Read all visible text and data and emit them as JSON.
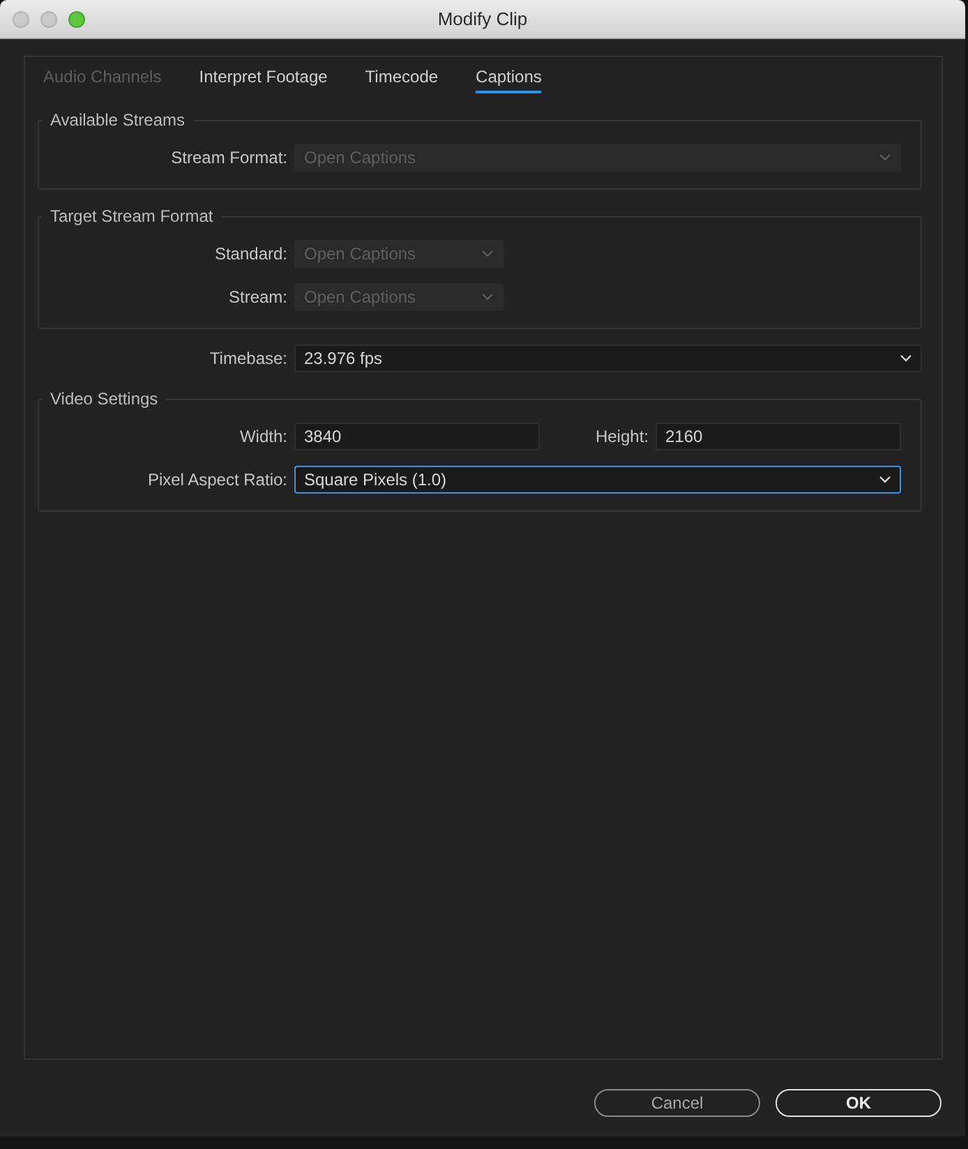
{
  "window": {
    "title": "Modify Clip"
  },
  "tabs": [
    {
      "label": "Audio Channels",
      "selected": false,
      "disabled": true
    },
    {
      "label": "Interpret Footage",
      "selected": false,
      "disabled": false
    },
    {
      "label": "Timecode",
      "selected": false,
      "disabled": false
    },
    {
      "label": "Captions",
      "selected": true,
      "disabled": false
    }
  ],
  "sections": [
    {
      "kind": "group",
      "title": "Available Streams",
      "rows": [
        {
          "fields": [
            {
              "kind": "dropdown",
              "label": "Stream Format:",
              "value": "Open Captions",
              "disabled": true,
              "focused": false
            }
          ]
        }
      ]
    },
    {
      "kind": "group",
      "title": "Target Stream Format",
      "rows": [
        {
          "fields": [
            {
              "kind": "compact-dropdown",
              "label": "Standard:",
              "value": "Open Captions",
              "disabled": true,
              "focused": false
            }
          ]
        },
        {
          "fields": [
            {
              "kind": "compact-dropdown",
              "label": "Stream:",
              "value": "Open Captions",
              "disabled": true,
              "focused": false
            }
          ]
        }
      ]
    },
    {
      "kind": "row",
      "fields": [
        {
          "kind": "dropdown",
          "label": "Timebase:",
          "value": "23.976 fps",
          "disabled": false,
          "focused": false
        }
      ]
    },
    {
      "kind": "group",
      "title": "Video Settings",
      "rows": [
        {
          "fields": [
            {
              "kind": "text",
              "label": "Width:",
              "value": "3840",
              "disabled": false,
              "focused": false
            },
            {
              "kind": "text",
              "label": "Height:",
              "value": "2160",
              "disabled": false,
              "focused": false
            }
          ]
        },
        {
          "fields": [
            {
              "kind": "dropdown",
              "label": "Pixel Aspect Ratio:",
              "value": "Square Pixels (1.0)",
              "disabled": false,
              "focused": true
            }
          ]
        }
      ]
    }
  ],
  "buttons": [
    {
      "label": "Cancel",
      "default": false
    },
    {
      "label": "OK",
      "default": true
    }
  ]
}
